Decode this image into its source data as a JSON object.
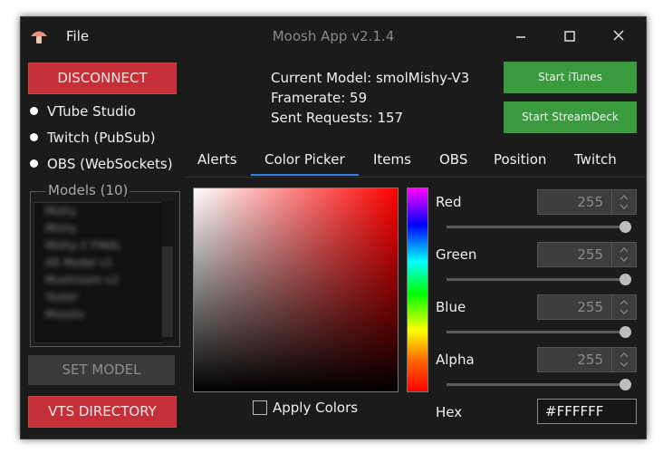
{
  "window": {
    "title": "Moosh App v2.1.4",
    "file_menu": "File"
  },
  "buttons": {
    "disconnect": "DISCONNECT",
    "set_model": "SET MODEL",
    "vts_directory": "VTS DIRECTORY",
    "start_itunes": "Start iTunes",
    "start_streamdeck": "Start StreamDeck"
  },
  "connections": [
    "VTube Studio",
    "Twitch (PubSub)",
    "OBS (WebSockets)"
  ],
  "models": {
    "label": "Models (10)",
    "items": [
      "Mishy",
      "Mishy",
      "Mishy-2 FINAL",
      "Alt Model v1",
      "Mushroom v2",
      "Yoster",
      "Mosoto"
    ]
  },
  "info": {
    "current_model": "Current Model: smolMishy-V3",
    "framerate": "Framerate: 59",
    "sent_requests": "Sent Requests: 157"
  },
  "tabs": [
    "Alerts",
    "Color Picker",
    "Items",
    "OBS",
    "Position",
    "Twitch"
  ],
  "active_tab": "Color Picker",
  "color_picker": {
    "apply_label": "Apply Colors",
    "channels": [
      {
        "label": "Red",
        "value": "255",
        "level": 1.0
      },
      {
        "label": "Green",
        "value": "255",
        "level": 1.0
      },
      {
        "label": "Blue",
        "value": "255",
        "level": 1.0
      },
      {
        "label": "Alpha",
        "value": "255",
        "level": 1.0
      }
    ],
    "hex_label": "Hex",
    "hex_value": "#FFFFFF"
  },
  "colors": {
    "red_button": "#c62f37",
    "green_button": "#3a9a3e",
    "tab_accent": "#3a7bd5",
    "background": "#1b1b1b"
  },
  "icons": {
    "app": "mushroom-icon",
    "minimize": "minimize-icon",
    "maximize": "maximize-icon",
    "close": "close-icon"
  }
}
